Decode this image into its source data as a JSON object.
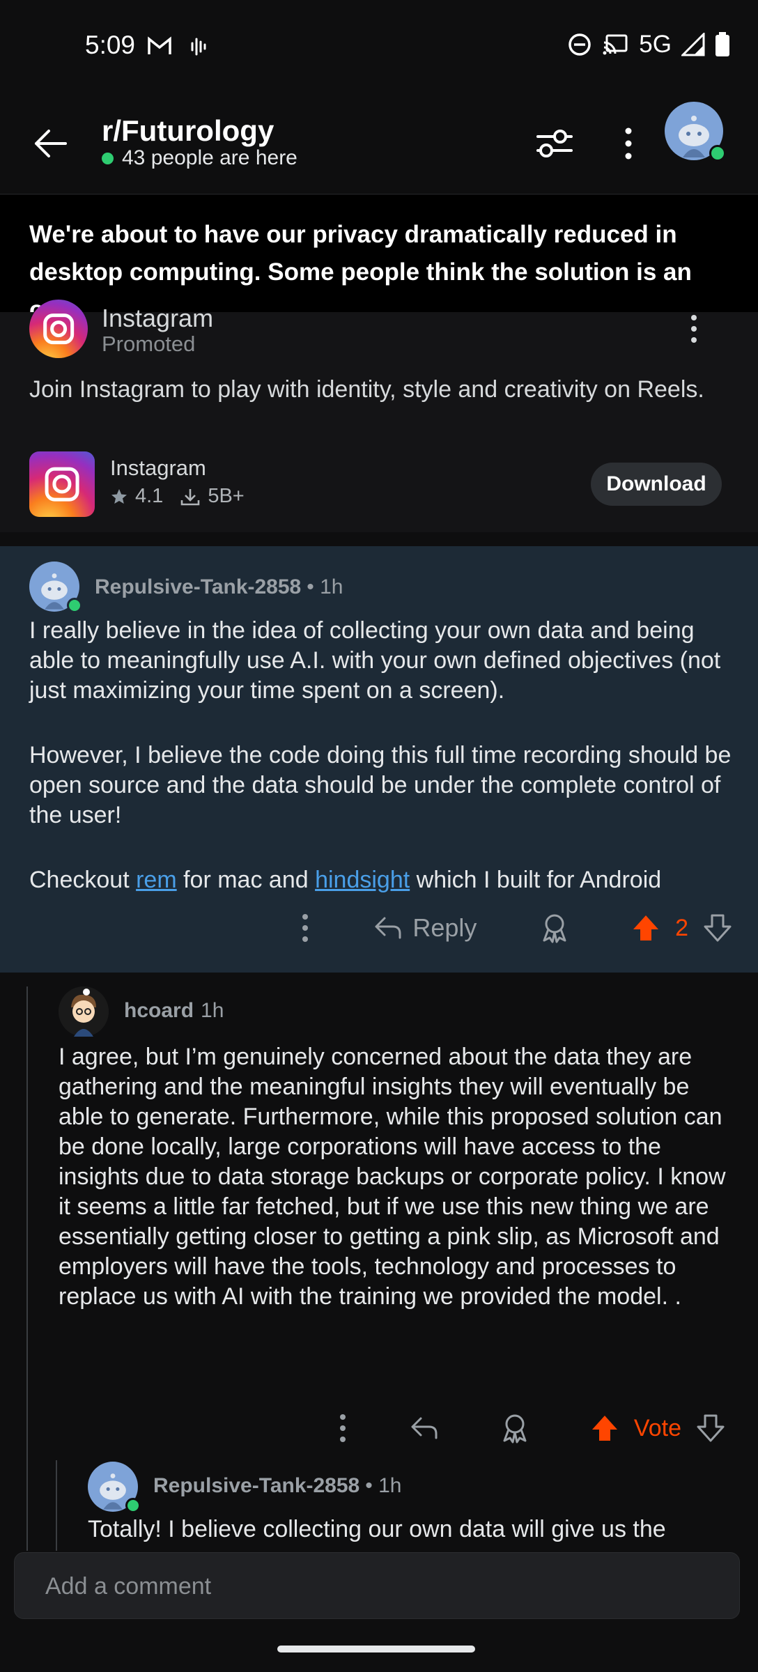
{
  "status_bar": {
    "time": "5:09",
    "network": "5G"
  },
  "header": {
    "subreddit": "r/Futurology",
    "online_text": "43 people are here"
  },
  "sticky_title": "We're about to have our privacy dramatically reduced in desktop computing. Some people think the solution is an op…",
  "promo": {
    "name": "Instagram",
    "tag": "Promoted",
    "text": "Join Instagram to play with identity, style and creativity on Reels.",
    "app_name": "Instagram",
    "rating": "4.1",
    "downloads": "5B+",
    "button": "Download"
  },
  "comment1": {
    "author": "Repulsive-Tank-2858",
    "time": "• 1h",
    "para1": "I really believe in the idea of collecting your own data and being able to meaningfully use A.I. with your own defined objectives (not just maximizing your time spent on a screen).",
    "para2": "However, I believe the code doing this full time recording should be open source and the data should be under the complete control of the user!",
    "p3_a": "Checkout ",
    "p3_link1": "rem",
    "p3_b": " for mac and ",
    "p3_link2": "hindsight",
    "p3_c": " which I built for Android",
    "reply_label": "Reply",
    "votes": "2"
  },
  "comment2": {
    "author": "hcoard",
    "time": "1h",
    "text": "I agree, but I’m genuinely concerned about the data they are gathering and the meaningful insights they will eventually be able to generate. Furthermore, while this proposed solution can be done locally, large corporations will have access to the insights due to data storage backups or corporate policy. I know it seems a little far fetched, but if we use this new thing we are essentially getting closer to getting a pink slip, as Microsoft and employers will have the tools, technology and processes to replace us with AI with the training we provided the model. .",
    "vote_label": "Vote"
  },
  "comment3": {
    "author": "Repulsive-Tank-2858",
    "time": "• 1h",
    "text": "Totally! I believe collecting our own data will give us the"
  },
  "comment_bar": {
    "placeholder": "Add a comment"
  }
}
